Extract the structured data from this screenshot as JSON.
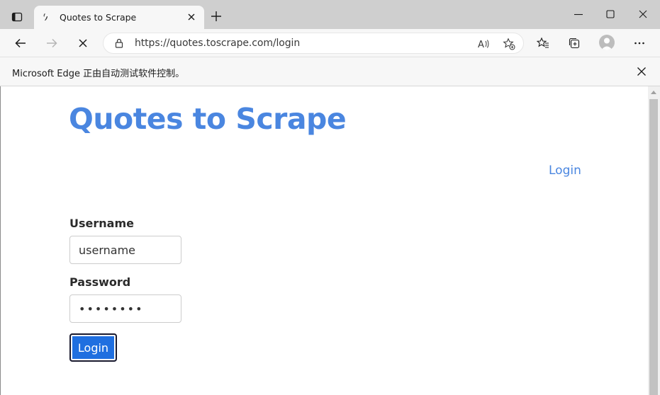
{
  "browser": {
    "tab": {
      "title": "Quotes to Scrape"
    },
    "address_bar": {
      "url": "https://quotes.toscrape.com/login"
    },
    "infobar": {
      "message": "Microsoft Edge 正由自动测试软件控制。"
    }
  },
  "page": {
    "site_title": "Quotes to Scrape",
    "nav_login_label": "Login",
    "form": {
      "username_label": "Username",
      "username_value": "username",
      "password_label": "Password",
      "password_value": "••••••••",
      "submit_label": "Login"
    }
  },
  "colors": {
    "brand_blue": "#4a86e0",
    "button_blue": "#1f6fe0"
  },
  "icons": [
    "tab-actions-icon",
    "favicon-icon",
    "close-icon",
    "plus-icon",
    "minimize-icon",
    "maximize-icon",
    "window-close-icon",
    "back-arrow-icon",
    "forward-arrow-icon",
    "stop-loading-icon",
    "lock-icon",
    "read-aloud-icon",
    "add-favorite-icon",
    "favorites-icon",
    "collections-icon",
    "profile-avatar-icon",
    "more-menu-icon"
  ]
}
